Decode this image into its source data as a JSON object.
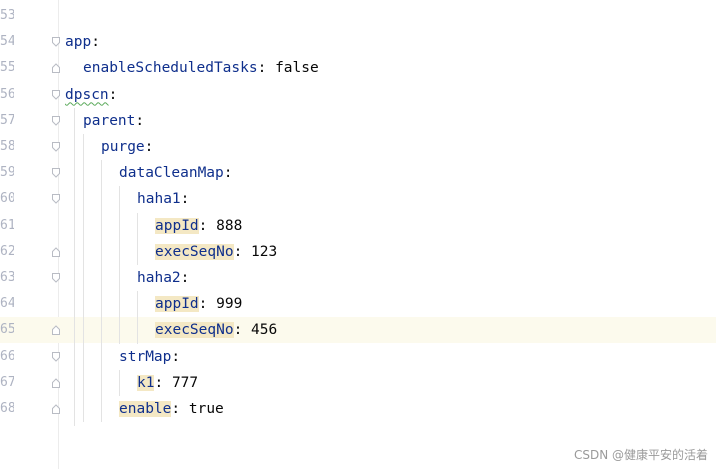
{
  "editor": {
    "lines": [
      {
        "no": "53",
        "indent": 0,
        "key": "",
        "sep": "",
        "value": ""
      },
      {
        "no": "54",
        "indent": 0,
        "key": "app",
        "sep": ":",
        "value": "",
        "fold": "open"
      },
      {
        "no": "55",
        "indent": 1,
        "key": "enableScheduledTasks",
        "sep": ": ",
        "value": "false",
        "fold": "end"
      },
      {
        "no": "56",
        "indent": 0,
        "key": "dpscn",
        "sep": ":",
        "value": "",
        "fold": "open",
        "squiggle": true
      },
      {
        "no": "57",
        "indent": 1,
        "key": "parent",
        "sep": ":",
        "value": "",
        "fold": "open"
      },
      {
        "no": "58",
        "indent": 2,
        "key": "purge",
        "sep": ":",
        "value": "",
        "fold": "open"
      },
      {
        "no": "59",
        "indent": 3,
        "key": "dataCleanMap",
        "sep": ":",
        "value": "",
        "fold": "open"
      },
      {
        "no": "60",
        "indent": 4,
        "key": "haha1",
        "sep": ":",
        "value": "",
        "fold": "open"
      },
      {
        "no": "61",
        "indent": 5,
        "key": "appId",
        "sep": ": ",
        "value": "888",
        "hl": true
      },
      {
        "no": "62",
        "indent": 5,
        "key": "execSeqNo",
        "sep": ": ",
        "value": "123",
        "hl": true,
        "fold": "end"
      },
      {
        "no": "63",
        "indent": 4,
        "key": "haha2",
        "sep": ":",
        "value": "",
        "fold": "open"
      },
      {
        "no": "64",
        "indent": 5,
        "key": "appId",
        "sep": ": ",
        "value": "999",
        "hl": true
      },
      {
        "no": "65",
        "indent": 5,
        "key": "execSeqNo",
        "sep": ": ",
        "value": "456",
        "hl": true,
        "fold": "end",
        "current": true
      },
      {
        "no": "66",
        "indent": 3,
        "key": "strMap",
        "sep": ":",
        "value": "",
        "fold": "open"
      },
      {
        "no": "67",
        "indent": 4,
        "key": "k1",
        "sep": ": ",
        "value": "777",
        "hl": true,
        "fold": "end"
      },
      {
        "no": "68",
        "indent": 3,
        "key": "enable",
        "sep": ": ",
        "value": "true",
        "hl": true,
        "fold": "end"
      }
    ]
  },
  "watermark": "CSDN @健康平安的活着",
  "colors": {
    "key": "#0f2f8c",
    "highlight": "#f4e8c4",
    "current_line": "#fcfaed"
  }
}
